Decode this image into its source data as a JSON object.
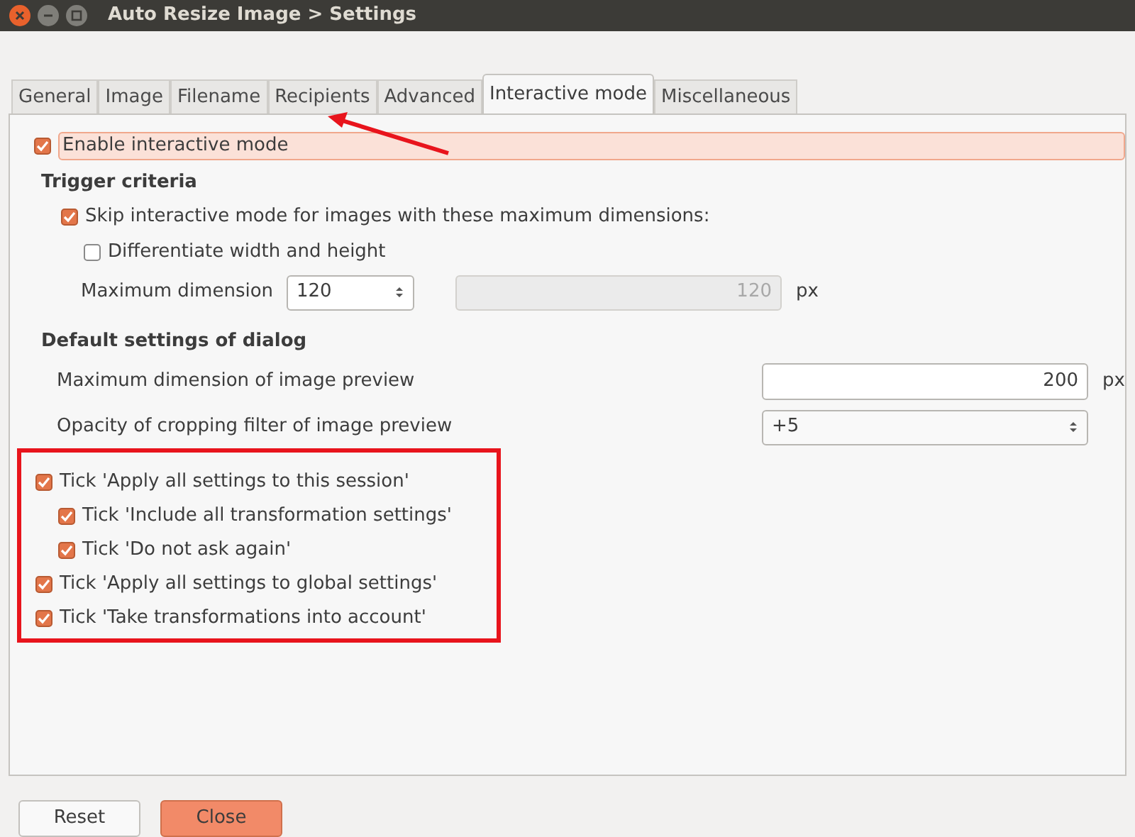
{
  "window": {
    "title": "Auto Resize Image > Settings"
  },
  "tabs": [
    {
      "label": "General",
      "selected": false
    },
    {
      "label": "Image",
      "selected": false
    },
    {
      "label": "Filename",
      "selected": false
    },
    {
      "label": "Recipients",
      "selected": false
    },
    {
      "label": "Advanced",
      "selected": false
    },
    {
      "label": "Interactive mode",
      "selected": true
    },
    {
      "label": "Miscellaneous",
      "selected": false
    }
  ],
  "enable": {
    "label": "Enable interactive mode",
    "checked": true,
    "highlighted": true
  },
  "trigger": {
    "heading": "Trigger criteria",
    "skip": {
      "label": "Skip interactive mode for images with these maximum dimensions:",
      "checked": true
    },
    "differentiate": {
      "label": "Differentiate width and height",
      "checked": false
    },
    "max_label": "Maximum dimension",
    "max_value": "120",
    "second_value": "120",
    "second_disabled": true,
    "unit": "px"
  },
  "dialog": {
    "heading": "Default settings of dialog",
    "preview_label": "Maximum dimension of image preview",
    "preview_value": "200",
    "preview_unit": "px",
    "opacity_label": "Opacity of cropping filter of image preview",
    "opacity_value": "+5"
  },
  "ticks": [
    {
      "label": "Tick 'Apply all settings to this session'",
      "checked": true,
      "children": [
        {
          "label": "Tick 'Include all transformation settings'",
          "checked": true
        },
        {
          "label": "Tick 'Do not ask again'",
          "checked": true
        }
      ]
    },
    {
      "label": "Tick 'Apply all settings to global settings'",
      "checked": true
    },
    {
      "label": "Tick 'Take transformations into account'",
      "checked": true
    }
  ],
  "buttons": [
    {
      "label": "Reset",
      "kind": "plain"
    },
    {
      "label": "Close",
      "kind": "primary"
    }
  ]
}
